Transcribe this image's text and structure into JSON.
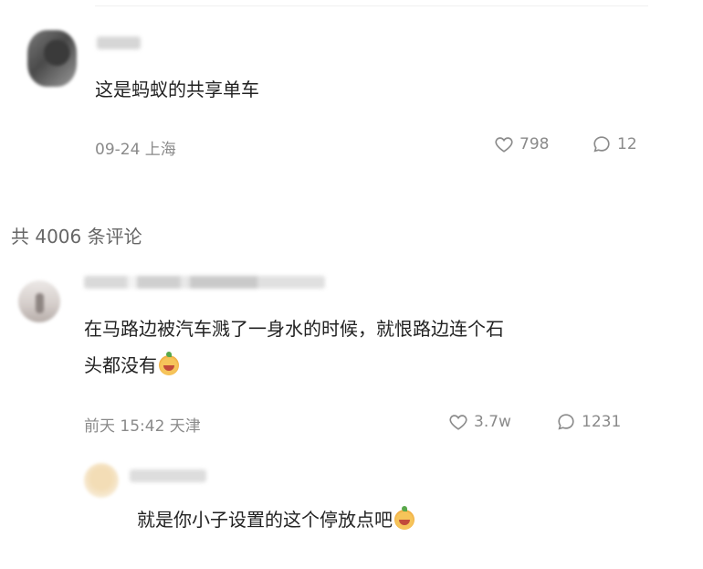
{
  "section_title": "共 4006 条评论",
  "comments": [
    {
      "text_lines": [
        "这是蚂蚁的共享单车"
      ],
      "meta": "09-24 上海",
      "likes": "798",
      "replies": "12"
    },
    {
      "text_lines": [
        "在马路边被汽车溅了一身水的时候，就恨路边连个石",
        "头都没有"
      ],
      "meta": "前天 15:42 天津",
      "likes": "3.7w",
      "replies": "1231",
      "emoji": "orange-face-emoji"
    },
    {
      "text_lines": [
        "就是你小子设置的这个停放点吧"
      ],
      "emoji": "orange-face-emoji"
    }
  ],
  "icons": {
    "like": "heart-icon",
    "reply": "comment-bubble-icon"
  }
}
